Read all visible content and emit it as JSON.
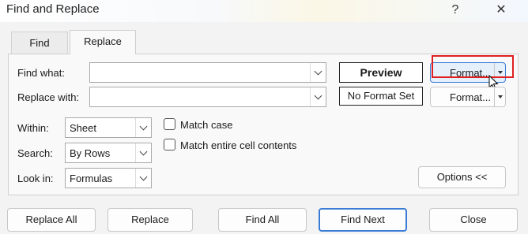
{
  "window": {
    "title": "Find and Replace",
    "help_glyph": "?",
    "close_glyph": "✕"
  },
  "tabs": [
    {
      "label": "Find",
      "active": false
    },
    {
      "label": "Replace",
      "active": true
    }
  ],
  "find_what": {
    "label": "Find what:",
    "value": ""
  },
  "replace_with": {
    "label": "Replace with:",
    "value": ""
  },
  "preview": {
    "find_format": "Preview",
    "replace_format": "No Format Set"
  },
  "format_buttons": {
    "find": "Format...",
    "replace": "Format..."
  },
  "options": {
    "within": {
      "label": "Within:",
      "value": "Sheet"
    },
    "search": {
      "label": "Search:",
      "value": "By Rows"
    },
    "look_in": {
      "label": "Look in:",
      "value": "Formulas"
    },
    "match_case": {
      "label": "Match case",
      "checked": false
    },
    "match_entire": {
      "label": "Match entire cell contents",
      "checked": false
    },
    "toggle_label": "Options <<"
  },
  "actions": {
    "replace_all": "Replace All",
    "replace": "Replace",
    "find_all": "Find All",
    "find_next": "Find Next",
    "close": "Close"
  },
  "colors": {
    "highlight": "#e02020",
    "focus": "#3a7bd5"
  }
}
